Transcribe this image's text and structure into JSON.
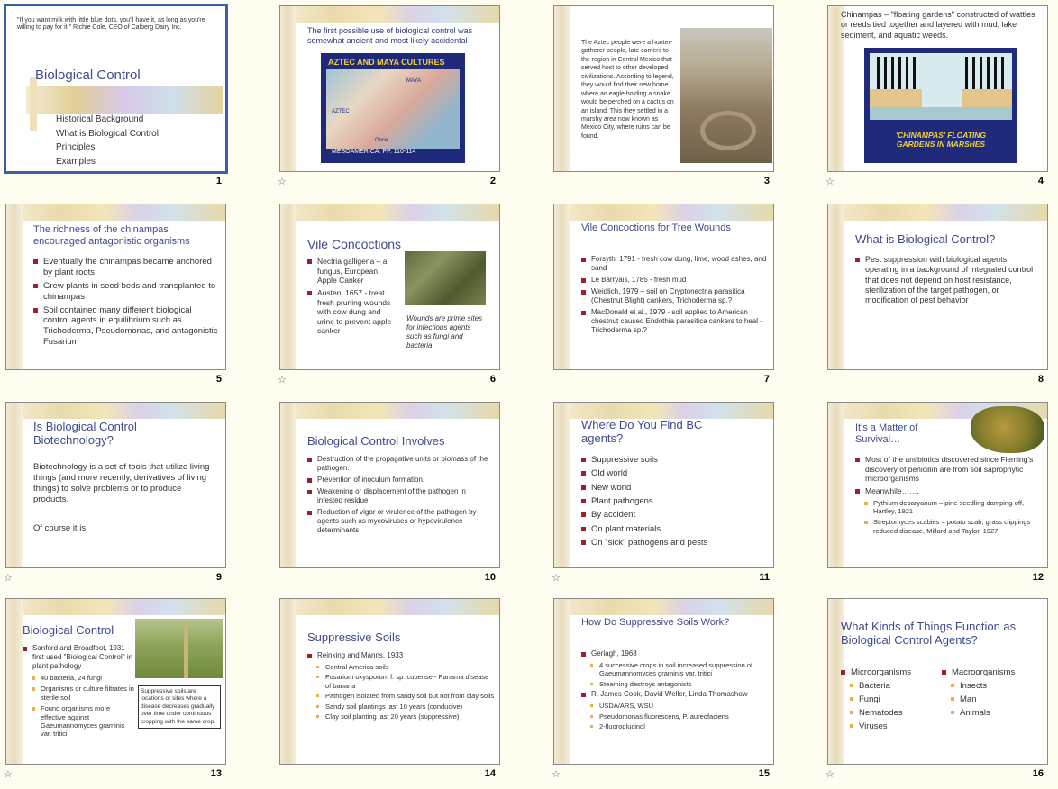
{
  "slides": [
    {
      "n": "1",
      "quote": "\"If you want milk with little blue dots, you'll have it, as long as you're willing to pay for it.\" Richie Cole, CEO of Calberg Dairy Inc.",
      "title": "Biological Control",
      "items": [
        "Historical Background",
        "What is Biological Control",
        "Principles",
        "Examples"
      ]
    },
    {
      "n": "2",
      "text": "The first possible use of biological control was somewhat ancient and most likely accidental",
      "map_title": "AZTEC AND MAYA CULTURES",
      "map_label_maya": "MAYA",
      "map_label_aztec": "AZTEC",
      "map_caption": "MESOAMERICA. PP. 110-114",
      "map_note": "Once"
    },
    {
      "n": "3",
      "text": "The Aztec people were a hunter-gatherer people, late comers to the region in Central Mexico that served host to other developed civilizations. According to legend, they would find their new home where an eagle holding a snake would be perched on a cactus on an island. This they settled in a marshy area now known as Mexico City, where ruins can be found."
    },
    {
      "n": "4",
      "text": "Chinampas – \"floating gardens\" constructed of wattles or reeds tied together and layered with mud, lake sediment, and aquatic weeds.",
      "caption": "'CHINAMPAS' FLOATING GARDENS IN MARSHES"
    },
    {
      "n": "5",
      "title": "The richness of the chinampas encouraged antagonistic organisms",
      "bullets": [
        "Eventually the chinampas became anchored by plant roots",
        "Grew plants in seed beds and transplanted to chinampas",
        "Soil contained many different biological control agents in equilibrium such as Trichoderma, Pseudomonas, and antagonistic Fusarium"
      ]
    },
    {
      "n": "6",
      "title": "Vile Concoctions",
      "bullets": [
        "Nectria galligena – a fungus, European Apple Canker",
        "Austen, 1657 - treat fresh pruning wounds with cow dung and urine to prevent apple canker"
      ],
      "note": "Wounds are prime sites for infectious agents such as fungi and bacteria"
    },
    {
      "n": "7",
      "title": "Vile Concoctions for Tree Wounds",
      "bullets": [
        "Forsyth, 1791 - fresh cow dung, lime, wood ashes, and sand",
        "Le Barryais, 1785 - fresh mud",
        "Weidlich, 1979 – soil on Cryptonectria parasitica (Chestnut Blight) cankers, Trichoderma sp.?",
        "MacDonald et al., 1979 - soil applied to American chestnut caused Endothia parasitica cankers to heal - Trichoderma sp.?"
      ]
    },
    {
      "n": "8",
      "title": "What is Biological Control?",
      "bullets": [
        "Pest suppression with biological agents operating in a background of integrated control that does not depend on host resistance, sterilization of the target pathogen, or modification of pest behavior"
      ]
    },
    {
      "n": "9",
      "title": "Is Biological Control Biotechnology?",
      "para1": "Biotechnology is a set of tools that utilize living things (and more recently, derivatives of living things) to solve problems or to produce products.",
      "para2": "Of course it is!"
    },
    {
      "n": "10",
      "title": "Biological Control Involves",
      "bullets": [
        "Destruction of the propagative units or biomass of the pathogen.",
        "Prevention of inoculum formation.",
        "Weakening or displacement of the pathogen in infested residue.",
        "Reduction of vigor or virulence of the pathogen by agents such as mycoviruses or hypovirulence determinants."
      ]
    },
    {
      "n": "11",
      "title": "Where Do You Find BC agents?",
      "bullets": [
        "Suppressive soils",
        "Old world",
        "New world",
        "Plant pathogens",
        "By accident",
        "On plant materials",
        "On \"sick\" pathogens and pests"
      ]
    },
    {
      "n": "12",
      "title": "It's a Matter of Survival…",
      "bullets": [
        "Most of the antibiotics discovered since Fleming's discovery of penicillin are from soil saprophytic microorganisms",
        "Meanwhile……."
      ],
      "sub": [
        "Pythium debaryanum – pine seedling damping-off, Hartley, 1921",
        "Streptomyces scabies – potato scab, grass clippings reduced disease, Millard and Taylor, 1927"
      ]
    },
    {
      "n": "13",
      "title": "Biological Control",
      "bullets": [
        "Sanford and Broadfoot, 1931 - first used \"Biological Control\" in plant pathology"
      ],
      "sub": [
        "40 bacteria, 24 fungi",
        "Organisms or culture filtrates in sterile soil",
        "Found organisms more effective against Gaeumannomyces graminis var. tritici"
      ],
      "box": "Suppressive soils are locations or sites where a disease decreases gradually over time under continuous cropping with the same crop."
    },
    {
      "n": "14",
      "title": "Suppressive Soils",
      "bullets": [
        "Reinking and Manns, 1933"
      ],
      "sub": [
        "Central America soils",
        "Fusarium oxysporum f. sp. cubense - Panama disease of banana",
        "Pathogen isolated from sandy soil but not from clay soils",
        "Sandy soil plantings last 10 years (conducive)",
        "Clay soil planting last 20 years (suppressive)"
      ]
    },
    {
      "n": "15",
      "title": "How Do Suppressive Soils Work?",
      "b1": "Gerlagh, 1968",
      "sub1": [
        "4 successive crops in soil increased suppression of Gaeumannomyces graminis var. tritici",
        "Steaming destroys antagonists"
      ],
      "b2": "R. James Cook, David Weller, Linda Thomashow",
      "sub2": [
        "USDA/ARS, WSU",
        "Pseudomonas fluorescens, P. aureofaciens",
        "2-fluoroglucinol"
      ]
    },
    {
      "n": "16",
      "title": "What Kinds of Things Function as Biological Control Agents?",
      "col1_head": "Microorganisms",
      "col1": [
        "Bacteria",
        "Fungi",
        "Nematodes",
        "Viruses"
      ],
      "col2_head": "Macroorganisms",
      "col2": [
        "Insects",
        "Man",
        "Animals"
      ]
    }
  ],
  "star_icon": "☆"
}
